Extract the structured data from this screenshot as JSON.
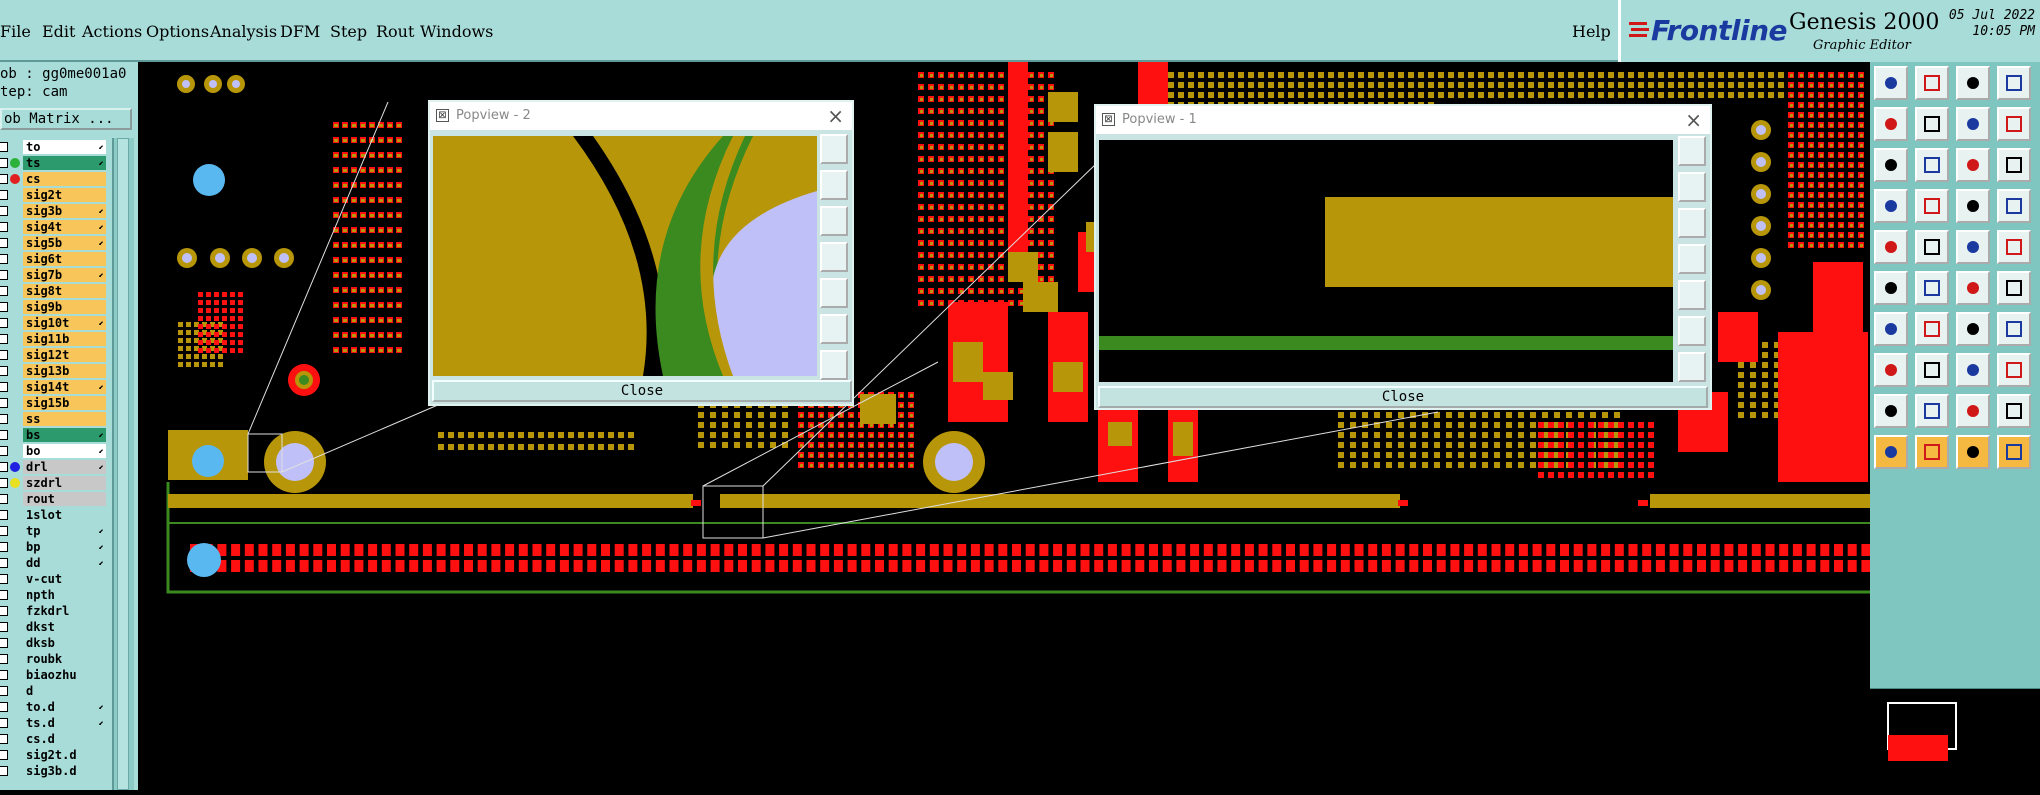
{
  "menu": {
    "items": [
      "File",
      "Edit",
      "Actions",
      "Options",
      "Analysis",
      "DFM",
      "Step",
      "Rout",
      "Windows"
    ],
    "help": "Help"
  },
  "brand": {
    "logo": "Frontline",
    "product": "Genesis 2000",
    "subtitle": "Graphic Editor",
    "date": "05 Jul 2022",
    "time": "10:05 PM"
  },
  "job": {
    "job_label": "ob : gg0me001a0",
    "step_label": "tep: cam",
    "matrix_button": "ob Matrix ..."
  },
  "layers": [
    {
      "name": "to",
      "bg": "#ffffff",
      "dot": "",
      "arrow": true
    },
    {
      "name": "ts",
      "bg": "#2d9a6e",
      "dot": "#2cb23a",
      "arrow": true
    },
    {
      "name": "cs",
      "bg": "#f7c55a",
      "dot": "#e02020",
      "arrow": false
    },
    {
      "name": "sig2t",
      "bg": "#f7c55a",
      "dot": "",
      "arrow": false
    },
    {
      "name": "sig3b",
      "bg": "#f7c55a",
      "dot": "",
      "arrow": true
    },
    {
      "name": "sig4t",
      "bg": "#f7c55a",
      "dot": "",
      "arrow": true
    },
    {
      "name": "sig5b",
      "bg": "#f7c55a",
      "dot": "",
      "arrow": true
    },
    {
      "name": "sig6t",
      "bg": "#f7c55a",
      "dot": "",
      "arrow": false
    },
    {
      "name": "sig7b",
      "bg": "#f7c55a",
      "dot": "",
      "arrow": true
    },
    {
      "name": "sig8t",
      "bg": "#f7c55a",
      "dot": "",
      "arrow": false
    },
    {
      "name": "sig9b",
      "bg": "#f7c55a",
      "dot": "",
      "arrow": false
    },
    {
      "name": "sig10t",
      "bg": "#f7c55a",
      "dot": "",
      "arrow": true
    },
    {
      "name": "sig11b",
      "bg": "#f7c55a",
      "dot": "",
      "arrow": false
    },
    {
      "name": "sig12t",
      "bg": "#f7c55a",
      "dot": "",
      "arrow": false
    },
    {
      "name": "sig13b",
      "bg": "#f7c55a",
      "dot": "",
      "arrow": false
    },
    {
      "name": "sig14t",
      "bg": "#f7c55a",
      "dot": "",
      "arrow": true
    },
    {
      "name": "sig15b",
      "bg": "#f7c55a",
      "dot": "",
      "arrow": false
    },
    {
      "name": "ss",
      "bg": "#f7c55a",
      "dot": "",
      "arrow": false
    },
    {
      "name": "bs",
      "bg": "#2d9a6e",
      "dot": "",
      "arrow": true
    },
    {
      "name": "bo",
      "bg": "#ffffff",
      "dot": "",
      "arrow": true
    },
    {
      "name": "drl",
      "bg": "#c8c8c8",
      "dot": "#2020e0",
      "arrow": true
    },
    {
      "name": "szdrl",
      "bg": "#c8c8c8",
      "dot": "#e8e020",
      "arrow": false
    },
    {
      "name": "rout",
      "bg": "#c8c8c8",
      "dot": "",
      "arrow": false
    },
    {
      "name": "1slot",
      "bg": "#a8dcd8",
      "dot": "",
      "arrow": false
    },
    {
      "name": "tp",
      "bg": "#a8dcd8",
      "dot": "",
      "arrow": true
    },
    {
      "name": "bp",
      "bg": "#a8dcd8",
      "dot": "",
      "arrow": true
    },
    {
      "name": "dd",
      "bg": "#a8dcd8",
      "dot": "",
      "arrow": true
    },
    {
      "name": "v-cut",
      "bg": "#a8dcd8",
      "dot": "",
      "arrow": false
    },
    {
      "name": "npth",
      "bg": "#a8dcd8",
      "dot": "",
      "arrow": false
    },
    {
      "name": "fzkdrl",
      "bg": "#a8dcd8",
      "dot": "",
      "arrow": false
    },
    {
      "name": "dkst",
      "bg": "#a8dcd8",
      "dot": "",
      "arrow": false
    },
    {
      "name": "dksb",
      "bg": "#a8dcd8",
      "dot": "",
      "arrow": false
    },
    {
      "name": "roubk",
      "bg": "#a8dcd8",
      "dot": "",
      "arrow": false
    },
    {
      "name": "biaozhu",
      "bg": "#a8dcd8",
      "dot": "",
      "arrow": false
    },
    {
      "name": "d",
      "bg": "#a8dcd8",
      "dot": "",
      "arrow": false
    },
    {
      "name": "to.d",
      "bg": "#a8dcd8",
      "dot": "",
      "arrow": true
    },
    {
      "name": "ts.d",
      "bg": "#a8dcd8",
      "dot": "",
      "arrow": true
    },
    {
      "name": "cs.d",
      "bg": "#a8dcd8",
      "dot": "",
      "arrow": false
    },
    {
      "name": "sig2t.d",
      "bg": "#a8dcd8",
      "dot": "",
      "arrow": false
    },
    {
      "name": "sig3b.d",
      "bg": "#a8dcd8",
      "dot": "",
      "arrow": false
    }
  ],
  "popview1": {
    "title": "Popview - 1",
    "close": "Close"
  },
  "popview2": {
    "title": "Popview - 2",
    "close": "Close"
  },
  "colors": {
    "copper": "#b8960a",
    "red": "#ff1010",
    "green": "#3a8a20",
    "drill": "#c0c0f8",
    "via": "#5ab8f0",
    "panel": "#a8dcd8"
  }
}
